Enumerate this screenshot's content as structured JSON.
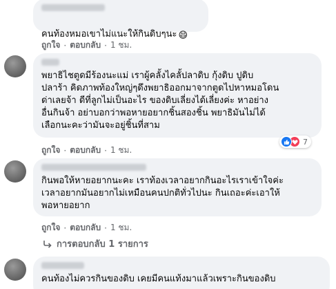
{
  "comments": [
    {
      "text": "คนท้องหมอเขาไม่แนะให้กินดิบๆนะ",
      "emoji": "😄",
      "actions": {
        "like": "ถูกใจ",
        "reply": "ตอบกลับ",
        "time": "1 ชม."
      }
    },
    {
      "text": "พยาธิไชตูดมีร้องนะแม่ เราผู้คลั้งไคลั้ปลาดิบ กุ้งดิบ ปูดิบ\nปลาร้า คิดภาพท้องใหญ่ๆดึงพยาธิออกมาจากตูดไปหาหมอโดน\nด่าเลยจ้า ดีที่ลูกไม่เป็นอะไร ของดิบเลี่ยงได้เลี่ยงค่ะ หาอย่าง\nอื่นกินจ้า อย่าบอกว่าพอหายอยากชิ้นสองชิ้น พยาธิมันไม่ได้\nเลือกนะคะว่ามันจะอยู่ชิ้นที่สาม",
      "actions": {
        "like": "ถูกใจ",
        "reply": "ตอบกลับ",
        "time": "1 ชม."
      },
      "reactions": {
        "count": "7",
        "icons": [
          "like-icon",
          "love-icon"
        ]
      }
    },
    {
      "text": "กินพอให้หายอยากนะคะ เราท้องเวลาอยากกินอะไรเราเข้าใจค่ะ\nเวลาอยากมันอยากไม่เหมือนคนปกติทั่วไปนะ กินเถอะค่ะเอาให้\nพอหายอยาก",
      "actions": {
        "like": "ถูกใจ",
        "reply": "ตอบกลับ",
        "time": "1 ชม."
      },
      "replies_label": "การตอบกลับ 1 รายการ"
    },
    {
      "text": "คนท้องไม่ควรกินของดิบ เคยมีคนแท้งมาแล้วเพราะกินของดิบ"
    }
  ],
  "colors": {
    "bubble": "#f0f2f5",
    "text": "#050505",
    "meta": "#65676b",
    "like": "#1877f2",
    "love": "#f33e58"
  }
}
